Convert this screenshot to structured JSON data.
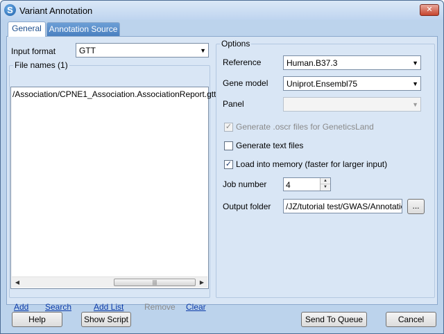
{
  "window": {
    "title": "Variant Annotation",
    "close_glyph": "✕"
  },
  "tabs": [
    {
      "label": "General"
    },
    {
      "label": "Annotation Source"
    }
  ],
  "general": {
    "input_format_label": "Input format",
    "input_format_value": "GTT",
    "file_names_label": "File names (1)",
    "files": [
      "/Association/CPNE1_Association.AssociationReport.gtt"
    ],
    "links": {
      "add": "Add",
      "search": "Search",
      "add_list": "Add List",
      "remove": "Remove",
      "clear": "Clear"
    }
  },
  "options": {
    "group_title": "Options",
    "reference_label": "Reference",
    "reference_value": "Human.B37.3",
    "gene_model_label": "Gene model",
    "gene_model_value": "Uniprot.Ensembl75",
    "panel_label": "Panel",
    "panel_value": "",
    "generate_oscr": {
      "label": "Generate .oscr files for GeneticsLand",
      "checked": true,
      "enabled": false
    },
    "generate_text": {
      "label": "Generate text files",
      "checked": false,
      "enabled": true
    },
    "load_memory": {
      "label": "Load into memory (faster for larger input)",
      "checked": true,
      "enabled": true
    },
    "job_number_label": "Job number",
    "job_number_value": "4",
    "output_folder_label": "Output folder",
    "output_folder_value": "/JZ/tutorial test/GWAS/Annotation",
    "browse_label": "..."
  },
  "footer": {
    "help": "Help",
    "show_script": "Show Script",
    "send_to_queue": "Send To Queue",
    "cancel": "Cancel"
  },
  "icons": {
    "app": "app-logo-icon",
    "close": "close-icon",
    "chevron": "chevron-down-icon"
  },
  "colors": {
    "title_bar": "#bed4ef",
    "panel_background": "#d9e6f5",
    "active_tab_text": "#1e4f8e",
    "link": "#0b3aa8",
    "close_button": "#c6452f"
  }
}
